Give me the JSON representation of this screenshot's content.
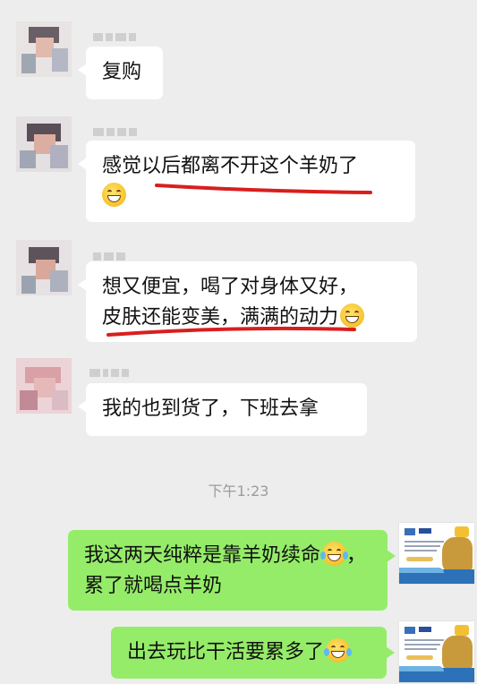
{
  "messages": [
    {
      "side": "left",
      "text": "复购"
    },
    {
      "side": "left",
      "text": "感觉以后都离不开这个羊奶了",
      "emoji": "grinning-face"
    },
    {
      "side": "left",
      "line1": "想又便宜，喝了对身体又好，",
      "line2": "皮肤还能变美，满满的动力",
      "emoji": "grinning-face"
    },
    {
      "side": "left",
      "text": "我的也到货了，下班去拿"
    },
    {
      "side": "right",
      "line1": "我这两天纯粹是靠羊奶续命",
      "line2": "，",
      "line3": "累了就喝点羊奶",
      "emoji": "laughing-crying-face"
    },
    {
      "side": "right",
      "text": "出去玩比干活要累多了",
      "emoji": "laughing-crying-face"
    }
  ],
  "timestamp": "下午1:23",
  "colors": {
    "background": "#ededed",
    "received_bubble": "#ffffff",
    "sent_bubble": "#95ec69",
    "underline": "#d81e1e",
    "timestamp": "#9c9c9c"
  }
}
